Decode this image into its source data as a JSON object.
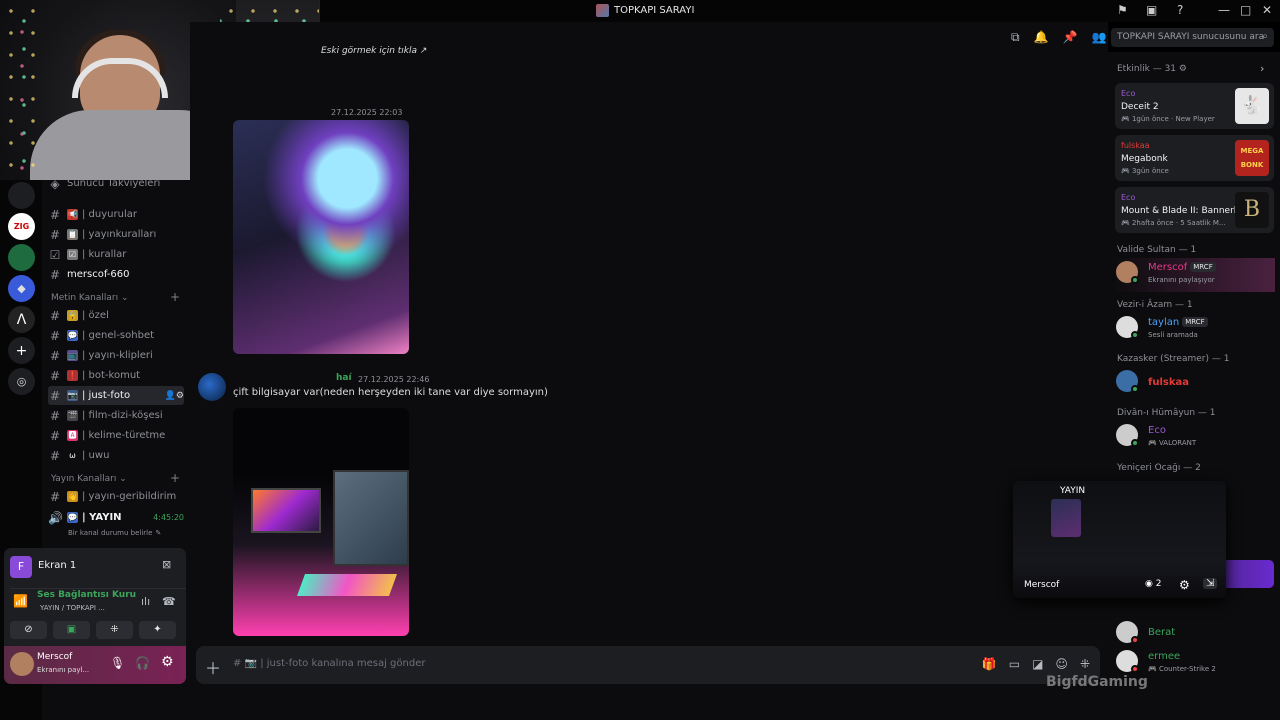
{
  "window": {
    "title": "TOPKAPI SARAYI"
  },
  "header": {
    "search_placeholder": "TOPKAPI SARAYI sunucusunu ara"
  },
  "sidebar": {
    "boost_label": "Sunucu Takviyeleri",
    "top_channels": [
      {
        "name": "| duyurular",
        "emoji": "📢"
      },
      {
        "name": "| yayınkuralları",
        "emoji": "📋"
      },
      {
        "name": "| kurallar",
        "emoji": "☑"
      },
      {
        "name": "merscof-660",
        "emoji": ""
      }
    ],
    "cat_text": "Metin Kanalları",
    "text_channels": [
      {
        "name": "| özel",
        "emoji": "🔒"
      },
      {
        "name": "| genel-sohbet",
        "emoji": "💬"
      },
      {
        "name": "| yayın-klipleri",
        "emoji": "📺"
      },
      {
        "name": "| bot-komut",
        "emoji": "❗"
      },
      {
        "name": "| just-foto",
        "emoji": "📷"
      },
      {
        "name": "| film-dizi-köşesi",
        "emoji": "🎬"
      },
      {
        "name": "| kelime-türetme",
        "emoji": "🅰"
      },
      {
        "name": "| uwu",
        "emoji": "ω"
      }
    ],
    "cat_stream": "Yayın Kanalları",
    "stream_channels": [
      {
        "name": "| yayın-geribildirim",
        "emoji": "👋"
      }
    ],
    "voice_channel": {
      "name": "| YAYIN",
      "time": "4:45:20",
      "status": "Bir kanal durumu belirle"
    }
  },
  "voice_panel": {
    "stream_title": "Ekran 1",
    "connection": "Ses Bağlantısı Kuru",
    "location": "YAYIN / TOPKAPI ...",
    "user": {
      "name": "Merscof",
      "status": "Ekranını payl..."
    }
  },
  "messages": [
    {
      "text": "Eski görmek için tıkla",
      "time": ""
    },
    {
      "text": "",
      "time": "27.12.2025 22:03"
    },
    {
      "author": "haí",
      "time": "27.12.2025 22:46",
      "text": "çift bilgisayar var(neden herşeyden iki tane var diye sormayın)"
    }
  ],
  "chatbox": {
    "placeholder": "just-foto kanalına mesaj gönder"
  },
  "members": {
    "activity_header": "Etkinlik — 31",
    "activities": [
      {
        "user": "Eco",
        "game": "Deceit 2",
        "time": "1gün önce",
        "extra": "New Player",
        "user_color": "#9b59d0"
      },
      {
        "user": "fulskaa",
        "game": "Megabonk",
        "time": "3gün önce",
        "extra": "",
        "user_color": "#e53935"
      },
      {
        "user": "Eco",
        "game": "Mount & Blade II: Bannerl...",
        "time": "2hafta önce",
        "extra": "5 Saatlik M...",
        "user_color": "#9b59d0"
      }
    ],
    "groups": [
      {
        "header": "Valide Sultan — 1",
        "name": "Merscof",
        "tag": "MRCF",
        "status": "Ekranını paylaşıyor",
        "color": "#e53987"
      },
      {
        "header": "Vezir-i Âzam — 1",
        "name": "taylan",
        "tag": "MRCF",
        "status": "Sesli aramada",
        "color": "#4aa3ff"
      },
      {
        "header": "Kazasker (Streamer) — 1",
        "name": "fulskaa",
        "tag": "",
        "status": "",
        "color": "#e53935"
      },
      {
        "header": "Divân-ı Hümâyun — 1",
        "name": "Eco",
        "tag": "",
        "status": "VALORANT",
        "color": "#9b59d0"
      }
    ],
    "yeniceri_header": "Yeniçeri Ocağı — 2",
    "extra_members": [
      {
        "name": "Berat",
        "status": "",
        "color": "#3ba55c"
      },
      {
        "name": "ermee",
        "status": "Counter-Strike 2",
        "color": "#3ba55c"
      }
    ]
  },
  "popout": {
    "label": "YAYIN",
    "name": "Merscof",
    "viewers": "2"
  },
  "watermark": "BigfdGaming"
}
